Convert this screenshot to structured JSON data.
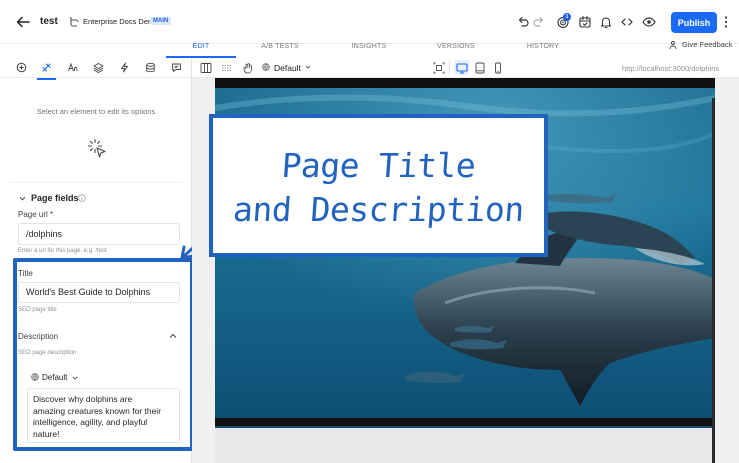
{
  "header": {
    "project_name": "test",
    "site_name": "Enterprise Docs Demo",
    "branch_badge": "MAIN",
    "notification_count": "1",
    "publish_label": "Publish"
  },
  "tabs": [
    {
      "label": "EDIT",
      "active": true
    },
    {
      "label": "A/B TESTS",
      "active": false
    },
    {
      "label": "INSIGHTS",
      "active": false
    },
    {
      "label": "VERSIONS",
      "active": false
    },
    {
      "label": "HISTORY",
      "active": false
    }
  ],
  "feedback_label": "Give Feedback",
  "left_panel": {
    "tool_icons": [
      "add-icon",
      "style-icon",
      "typography-icon",
      "layers-icon",
      "interactions-icon",
      "database-icon",
      "comments-icon"
    ],
    "empty_hint": "Select an element to edit its options",
    "page_fields_title": "Page fields",
    "page_url_label": "Page url *",
    "page_url_value": "/dolphins",
    "page_url_hint": "Enter a url for this page, e.g. /test",
    "title_label": "Title",
    "title_value": "World's Best Guide to Dolphins",
    "title_hint": "SEO page title",
    "description_label": "Description",
    "description_hint": "SEO page description",
    "locale": "Default",
    "description_value": "Discover why dolphins are\namazing creatures known for their\nintelligence, agility, and playful\nnature!"
  },
  "canvas_bar": {
    "locale": "Default",
    "url": "http://localhost:3000/dolphins"
  },
  "callout": {
    "line1": "Page Title",
    "line2": "and Description"
  },
  "colors": {
    "accent": "#1a6af3",
    "annotation_blue": "#2163bd",
    "ocean_dark": "#0b3a5c",
    "ocean_light": "#2c7fa8"
  }
}
